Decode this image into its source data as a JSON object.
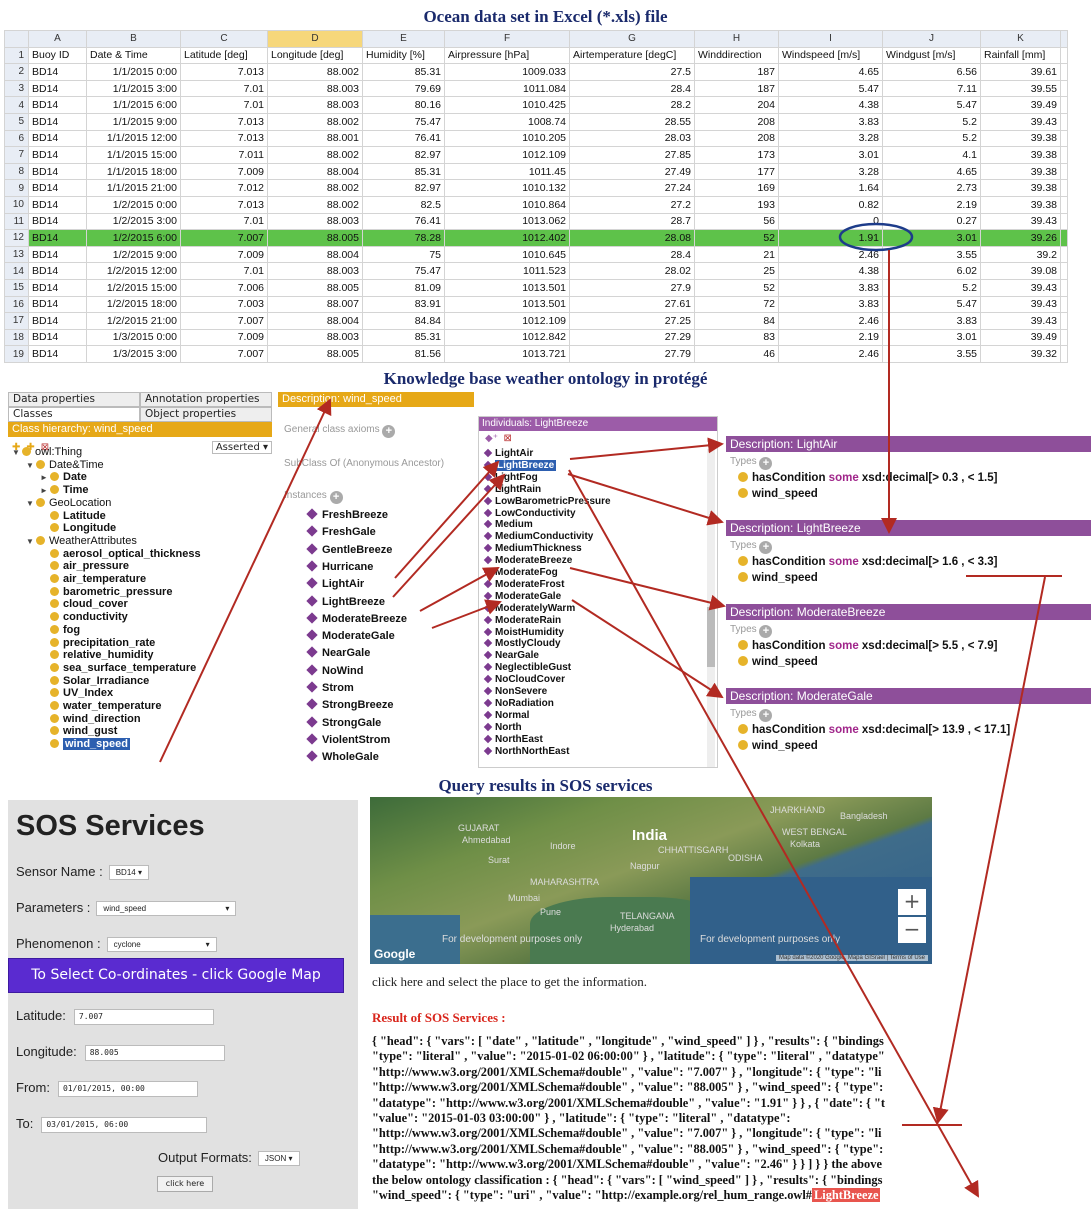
{
  "titles": {
    "excel": "Ocean data set in Excel (*.xls) file",
    "protege": "Knowledge base weather ontology in protégé",
    "sos": "Query results in SOS services"
  },
  "excel": {
    "col_letters": [
      "A",
      "B",
      "C",
      "D",
      "E",
      "F",
      "G",
      "H",
      "I",
      "J",
      "K"
    ],
    "header_row_number": "1",
    "headers": [
      "Buoy ID",
      "Date & Time",
      "Latitude [deg]",
      "Longitude [deg]",
      "Humidity [%]",
      "Airpressure [hPa]",
      "Airtemperature [degC]",
      "Winddirection",
      "Windspeed [m/s]",
      "Windgust [m/s]",
      "Rainfall [mm]"
    ],
    "rows": [
      {
        "n": "2",
        "c": [
          "BD14",
          "1/1/2015 0:00",
          "7.013",
          "88.002",
          "85.31",
          "1009.033",
          "27.5",
          "187",
          "4.65",
          "6.56",
          "39.61"
        ]
      },
      {
        "n": "3",
        "c": [
          "BD14",
          "1/1/2015 3:00",
          "7.01",
          "88.003",
          "79.69",
          "1011.084",
          "28.4",
          "187",
          "5.47",
          "7.11",
          "39.55"
        ]
      },
      {
        "n": "4",
        "c": [
          "BD14",
          "1/1/2015 6:00",
          "7.01",
          "88.003",
          "80.16",
          "1010.425",
          "28.2",
          "204",
          "4.38",
          "5.47",
          "39.49"
        ]
      },
      {
        "n": "5",
        "c": [
          "BD14",
          "1/1/2015 9:00",
          "7.013",
          "88.002",
          "75.47",
          "1008.74",
          "28.55",
          "208",
          "3.83",
          "5.2",
          "39.43"
        ]
      },
      {
        "n": "6",
        "c": [
          "BD14",
          "1/1/2015 12:00",
          "7.013",
          "88.001",
          "76.41",
          "1010.205",
          "28.03",
          "208",
          "3.28",
          "5.2",
          "39.38"
        ]
      },
      {
        "n": "7",
        "c": [
          "BD14",
          "1/1/2015 15:00",
          "7.011",
          "88.002",
          "82.97",
          "1012.109",
          "27.85",
          "173",
          "3.01",
          "4.1",
          "39.38"
        ]
      },
      {
        "n": "8",
        "c": [
          "BD14",
          "1/1/2015 18:00",
          "7.009",
          "88.004",
          "85.31",
          "1011.45",
          "27.49",
          "177",
          "3.28",
          "4.65",
          "39.38"
        ]
      },
      {
        "n": "9",
        "c": [
          "BD14",
          "1/1/2015 21:00",
          "7.012",
          "88.002",
          "82.97",
          "1010.132",
          "27.24",
          "169",
          "1.64",
          "2.73",
          "39.38"
        ]
      },
      {
        "n": "10",
        "c": [
          "BD14",
          "1/2/2015 0:00",
          "7.013",
          "88.002",
          "82.5",
          "1010.864",
          "27.2",
          "193",
          "0.82",
          "2.19",
          "39.38"
        ]
      },
      {
        "n": "11",
        "c": [
          "BD14",
          "1/2/2015 3:00",
          "7.01",
          "88.003",
          "76.41",
          "1013.062",
          "28.7",
          "56",
          "0",
          "0.27",
          "39.43"
        ]
      },
      {
        "n": "12",
        "c": [
          "BD14",
          "1/2/2015 6:00",
          "7.007",
          "88.005",
          "78.28",
          "1012.402",
          "28.08",
          "52",
          "1.91",
          "3.01",
          "39.26"
        ],
        "hl": true
      },
      {
        "n": "13",
        "c": [
          "BD14",
          "1/2/2015 9:00",
          "7.009",
          "88.004",
          "75",
          "1010.645",
          "28.4",
          "21",
          "2.46",
          "3.55",
          "39.2"
        ]
      },
      {
        "n": "14",
        "c": [
          "BD14",
          "1/2/2015 12:00",
          "7.01",
          "88.003",
          "75.47",
          "1011.523",
          "28.02",
          "25",
          "4.38",
          "6.02",
          "39.08"
        ]
      },
      {
        "n": "15",
        "c": [
          "BD14",
          "1/2/2015 15:00",
          "7.006",
          "88.005",
          "81.09",
          "1013.501",
          "27.9",
          "52",
          "3.83",
          "5.2",
          "39.43"
        ]
      },
      {
        "n": "16",
        "c": [
          "BD14",
          "1/2/2015 18:00",
          "7.003",
          "88.007",
          "83.91",
          "1013.501",
          "27.61",
          "72",
          "3.83",
          "5.47",
          "39.43"
        ]
      },
      {
        "n": "17",
        "c": [
          "BD14",
          "1/2/2015 21:00",
          "7.007",
          "88.004",
          "84.84",
          "1012.109",
          "27.25",
          "84",
          "2.46",
          "3.83",
          "39.43"
        ]
      },
      {
        "n": "18",
        "c": [
          "BD14",
          "1/3/2015 0:00",
          "7.009",
          "88.003",
          "85.31",
          "1012.842",
          "27.29",
          "83",
          "2.19",
          "3.01",
          "39.49"
        ]
      },
      {
        "n": "19",
        "c": [
          "BD14",
          "1/3/2015 3:00",
          "7.007",
          "88.005",
          "81.56",
          "1013.721",
          "27.79",
          "46",
          "2.46",
          "3.55",
          "39.32"
        ]
      }
    ]
  },
  "protege": {
    "tabs": [
      "Data properties",
      "Annotation properties",
      "Classes",
      "Object properties"
    ],
    "class_hierarchy_title": "Class hierarchy: wind_speed",
    "asserted": "Asserted",
    "tree": [
      {
        "label": "owl:Thing",
        "lvl": 0,
        "tri": "▼",
        "bold": false
      },
      {
        "label": "Date&Time",
        "lvl": 1,
        "tri": "▼",
        "bold": false
      },
      {
        "label": "Date",
        "lvl": 2,
        "tri": "►",
        "bold": true
      },
      {
        "label": "Time",
        "lvl": 2,
        "tri": "►",
        "bold": true
      },
      {
        "label": "GeoLocation",
        "lvl": 1,
        "tri": "▼",
        "bold": false
      },
      {
        "label": "Latitude",
        "lvl": 2,
        "tri": "",
        "bold": true
      },
      {
        "label": "Longitude",
        "lvl": 2,
        "tri": "",
        "bold": true
      },
      {
        "label": "WeatherAttributes",
        "lvl": 1,
        "tri": "▼",
        "bold": false
      },
      {
        "label": "aerosol_optical_thickness",
        "lvl": 2,
        "tri": "",
        "bold": true
      },
      {
        "label": "air_pressure",
        "lvl": 2,
        "tri": "",
        "bold": true
      },
      {
        "label": "air_temperature",
        "lvl": 2,
        "tri": "",
        "bold": true
      },
      {
        "label": "barometric_pressure",
        "lvl": 2,
        "tri": "",
        "bold": true
      },
      {
        "label": "cloud_cover",
        "lvl": 2,
        "tri": "",
        "bold": true
      },
      {
        "label": "conductivity",
        "lvl": 2,
        "tri": "",
        "bold": true
      },
      {
        "label": "fog",
        "lvl": 2,
        "tri": "",
        "bold": true
      },
      {
        "label": "precipitation_rate",
        "lvl": 2,
        "tri": "",
        "bold": true
      },
      {
        "label": "relative_humidity",
        "lvl": 2,
        "tri": "",
        "bold": true
      },
      {
        "label": "sea_surface_temperature",
        "lvl": 2,
        "tri": "",
        "bold": true
      },
      {
        "label": "Solar_Irradiance",
        "lvl": 2,
        "tri": "",
        "bold": true
      },
      {
        "label": "UV_Index",
        "lvl": 2,
        "tri": "",
        "bold": true
      },
      {
        "label": "water_temperature",
        "lvl": 2,
        "tri": "",
        "bold": true
      },
      {
        "label": "wind_direction",
        "lvl": 2,
        "tri": "",
        "bold": true
      },
      {
        "label": "wind_gust",
        "lvl": 2,
        "tri": "",
        "bold": true
      },
      {
        "label": "wind_speed",
        "lvl": 2,
        "tri": "",
        "bold": true,
        "sel": true
      }
    ],
    "description_title": "Description: wind_speed",
    "general_class_axioms": "General class axioms",
    "subclass_of": "SubClass Of (Anonymous Ancestor)",
    "instances_label": "Instances",
    "instances": [
      "FreshBreeze",
      "FreshGale",
      "GentleBreeze",
      "Hurricane",
      "LightAir",
      "LightBreeze",
      "ModerateBreeze",
      "ModerateGale",
      "NearGale",
      "NoWind",
      "Strom",
      "StrongBreeze",
      "StrongGale",
      "ViolentStrom",
      "WholeGale"
    ],
    "individuals_title": "Individuals: LightBreeze",
    "individuals": [
      "LightAir",
      "LightBreeze",
      "LightFog",
      "LightRain",
      "LowBarometricPressure",
      "LowConductivity",
      "Medium",
      "MediumConductivity",
      "MediumThickness",
      "ModerateBreeze",
      "ModerateFog",
      "ModerateFrost",
      "ModerateGale",
      "ModeratelyWarm",
      "ModerateRain",
      "MoistHumidity",
      "MostlyCloudy",
      "NearGale",
      "NeglectibleGust",
      "NoCloudCover",
      "NonSevere",
      "NoRadiation",
      "Normal",
      "North",
      "NorthEast",
      "NorthNorthEast"
    ],
    "selected_individual": "LightBreeze",
    "types_label": "Types",
    "descriptions": [
      {
        "title": "Description: LightAir",
        "cond_pre": "hasCondition ",
        "cond_kw": "some",
        "cond_post": " xsd:decimal[> 0.3 , < 1.5]",
        "cls": "wind_speed"
      },
      {
        "title": "Description: LightBreeze",
        "cond_pre": "hasCondition ",
        "cond_kw": "some",
        "cond_post": " xsd:decimal[> 1.6 , < 3.3]",
        "cls": "wind_speed"
      },
      {
        "title": "Description: ModerateBreeze",
        "cond_pre": "hasCondition ",
        "cond_kw": "some",
        "cond_post": " xsd:decimal[> 5.5 , < 7.9]",
        "cls": "wind_speed"
      },
      {
        "title": "Description: ModerateGale",
        "cond_pre": "hasCondition ",
        "cond_kw": "some",
        "cond_post": " xsd:decimal[> 13.9 , < 17.1]",
        "cls": "wind_speed"
      }
    ]
  },
  "sos": {
    "title": "SOS Services",
    "sensor_label": "Sensor Name :",
    "sensor_value": "BD14",
    "parameters_label": "Parameters :",
    "parameters_value": "wind_speed",
    "phenomenon_label": "Phenomenon :",
    "phenomenon_value": "cyclone",
    "select_coords_button": "To Select Co-ordinates - click Google Map",
    "latitude_label": "Latitude:",
    "latitude_value": "7.007",
    "longitude_label": "Longitude:",
    "longitude_value": "88.005",
    "from_label": "From:",
    "from_value": "01/01/2015, 00:00",
    "to_label": "To:",
    "to_value": "03/01/2015, 06:00",
    "output_label": "Output Formats:",
    "output_value": "JSON",
    "click_here_button": "click here",
    "map": {
      "country": "India",
      "places": [
        "Bangladesh",
        "JHARKHAND",
        "WEST BENGAL",
        "Kolkata",
        "Ahmedabad",
        "GUJARAT",
        "CHHATTISGARH",
        "ODISHA",
        "MAHARASHTRA",
        "Mumbai",
        "Pune",
        "TELANGANA",
        "Hyderabad",
        "Surat",
        "Indore",
        "Nagpur"
      ],
      "dev_notice": "For development purposes only",
      "footer": "Map data ©2020 Google, Mapa GISrael | Terms of Use",
      "logo": "Google",
      "zoom_in": "+",
      "zoom_out": "−"
    },
    "click_text": "click here and select the place to get the information.",
    "result_title": "Result of SOS Services :",
    "json_lines": [
      "{ \"head\": { \"vars\": [ \"date\" , \"latitude\" , \"longitude\" , \"wind_speed\" ] } , \"results\": { \"bindings",
      "\"type\": \"literal\" , \"value\": \"2015-01-02 06:00:00\" } , \"latitude\": { \"type\": \"literal\" , \"datatype\"",
      "\"http://www.w3.org/2001/XMLSchema#double\" , \"value\": \"7.007\" } , \"longitude\": { \"type\": \"li",
      "\"http://www.w3.org/2001/XMLSchema#double\" , \"value\": \"88.005\" } , \"wind_speed\": { \"type\":",
      "\"datatype\": \"http://www.w3.org/2001/XMLSchema#double\" , \"value\": \"1.91\" } } , { \"date\": { \"t",
      "\"value\": \"2015-01-03 03:00:00\" } , \"latitude\": { \"type\": \"literal\" , \"datatype\":",
      "\"http://www.w3.org/2001/XMLSchema#double\" , \"value\": \"7.007\" } , \"longitude\": { \"type\": \"li",
      "\"http://www.w3.org/2001/XMLSchema#double\" , \"value\": \"88.005\" } , \"wind_speed\": { \"type\":",
      "\"datatype\": \"http://www.w3.org/2001/XMLSchema#double\" , \"value\": \"2.46\" } } ] } } the above",
      "the below ontology classification : { \"head\": { \"vars\": [ \"wind_speed\" ] } , \"results\": { \"bindings",
      "\"wind_speed\": { \"type\": \"uri\" , \"value\": \"http://example.org/rel_hum_range.owl#"
    ],
    "json_result_class": "LightBreeze"
  },
  "colors": {
    "highlight_row": "#5ec24a",
    "arrow": "#b22a22",
    "protege_orange": "#e6a817",
    "protege_purple": "#8e4f9a",
    "sos_button": "#5a2bd0",
    "result_red": "#d9261c"
  }
}
